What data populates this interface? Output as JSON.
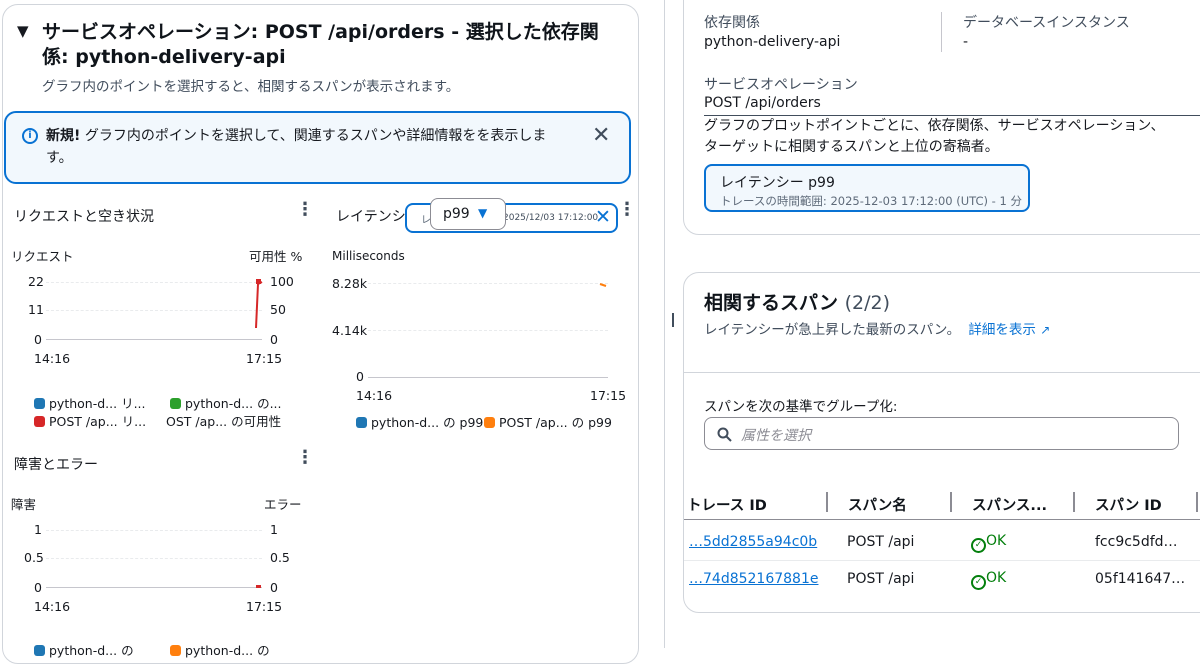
{
  "left": {
    "title": "サービスオペレーション: POST /api/orders - 選択した依存関係: python-delivery-api",
    "title_line1": "サービスオペレーション: POST /api/orders - 選択した依存関",
    "title_line2": "係: python-delivery-api",
    "subtitle": "グラフ内のポイントを選択すると、相関するスパンが表示されます。",
    "info": {
      "strong": "新規!",
      "text_line1": " グラフ内のポイントを選択して、関連するスパンや詳細情報をを表示しま",
      "text_line2": "す。"
    },
    "charts": {
      "requests": {
        "title": "リクエストと空き状況",
        "left_axis_label": "リクエスト",
        "right_axis_label": "可用性 %",
        "left_ticks": [
          "22",
          "11",
          "0"
        ],
        "right_ticks": [
          "100",
          "50",
          "0"
        ],
        "x_ticks": [
          "14:16",
          "17:15"
        ],
        "legend": [
          {
            "label": "python-d... リ...",
            "color": "#1f77b4"
          },
          {
            "label": "python-d... の...",
            "color": "#2ca02c"
          },
          {
            "label": "POST /ap... リ...",
            "color": "#d62728"
          },
          {
            "label": "OST /ap... の可用性",
            "color": ""
          }
        ]
      },
      "latency": {
        "title": "レイテンシー",
        "popover_hint": "レ",
        "popover_date": "2025/12/03 17:12:00",
        "selected_stat": "p99",
        "unit_label": "Milliseconds",
        "y_ticks": [
          "8.28k",
          "4.14k",
          "0"
        ],
        "x_ticks": [
          "14:16",
          "17:15"
        ],
        "legend": [
          {
            "label": "python-d... の p99",
            "color": "#1f77b4"
          },
          {
            "label": "POST /ap... の p99",
            "color": "#ff7f0e"
          }
        ]
      },
      "faults": {
        "title": "障害とエラー",
        "left_axis_label": "障害",
        "right_axis_label": "エラー",
        "left_ticks": [
          "1",
          "0.5",
          "0"
        ],
        "right_ticks": [
          "1",
          "0.5",
          "0"
        ],
        "x_ticks": [
          "14:16",
          "17:15"
        ],
        "legend": [
          {
            "label": "python-d... の",
            "color": "#1f77b4"
          },
          {
            "label": "python-d... の",
            "color": "#ff7f0e"
          }
        ]
      }
    }
  },
  "details": {
    "dependency_label": "依存関係",
    "dependency_value": "python-delivery-api",
    "db_label": "データベースインスタンス",
    "db_value": "-",
    "operation_label": "サービスオペレーション",
    "operation_value": "POST /api/orders",
    "description_line1": "グラフのプロットポイントごとに、依存関係、サービスオペレーション、",
    "description_line2": "ターゲットに相関するスパンと上位の寄稿者。",
    "badge_title": "レイテンシー p99",
    "badge_sub": "トレースの時間範囲: 2025-12-03 17:12:00 (UTC) - 1 分"
  },
  "spans": {
    "title": "相関するスパン",
    "count": "(2/2)",
    "subtitle": "レイテンシーが急上昇した最新のスパン。",
    "details_link": "詳細を表示",
    "group_label": "スパンを次の基準でグループ化:",
    "search_placeholder": "属性を選択",
    "columns": [
      "トレース ID",
      "スパン名",
      "スパンス...",
      "スパン ID"
    ],
    "rows": [
      {
        "trace_id": "…5dd2855a94c0b",
        "span_name": "POST /api",
        "status": "OK",
        "span_id": "fcc9c5dfd…"
      },
      {
        "trace_id": "…74d852167881e",
        "span_name": "POST /api",
        "status": "OK",
        "span_id": "05f141647…"
      }
    ]
  },
  "colors": {
    "accent": "#0972d3",
    "ok": "#037f0c",
    "error_red": "#d62728",
    "latency_orange": "#ff7f0e"
  }
}
